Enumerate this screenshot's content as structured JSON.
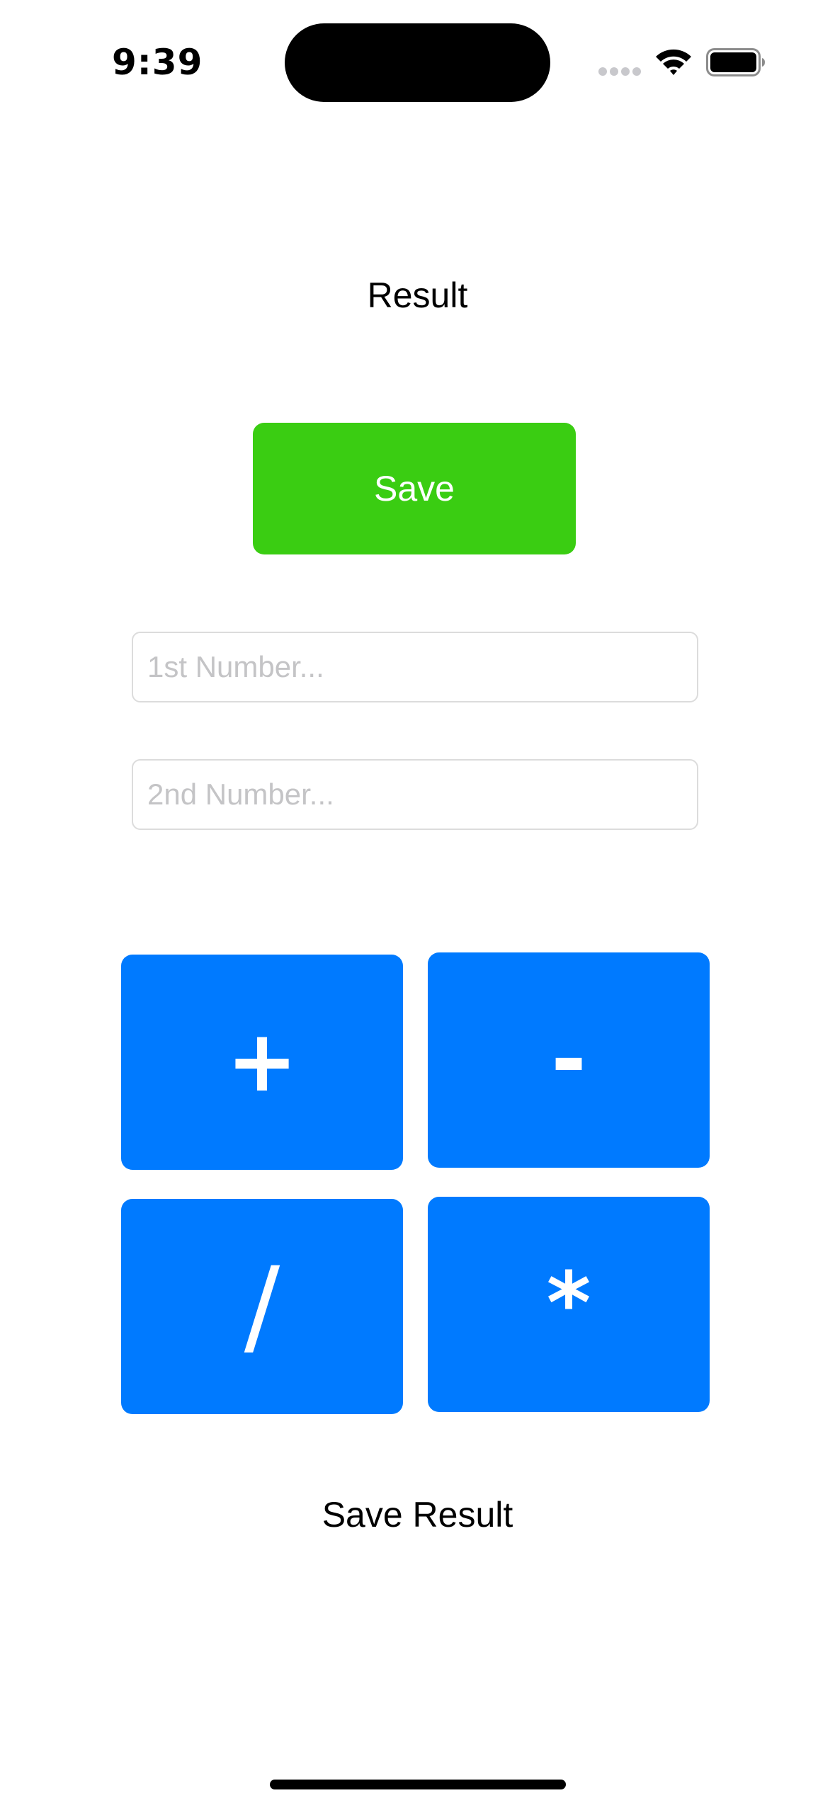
{
  "status_bar": {
    "time": "9:39",
    "icons": [
      "signal-icon",
      "wifi-icon",
      "battery-icon"
    ]
  },
  "main": {
    "result_label": "Result",
    "save_button_label": "Save",
    "first_number": {
      "value": "",
      "placeholder": "1st Number..."
    },
    "second_number": {
      "value": "",
      "placeholder": "2nd Number..."
    },
    "operations": [
      {
        "label": "+"
      },
      {
        "label": "-"
      },
      {
        "label": "/"
      },
      {
        "label": "*"
      }
    ],
    "save_result_label": "Save Result"
  },
  "colors": {
    "save_button": "#3acd12",
    "operation_button": "#007aff",
    "field_border": "#dcdcdc",
    "placeholder_text": "#c4c4c6"
  }
}
